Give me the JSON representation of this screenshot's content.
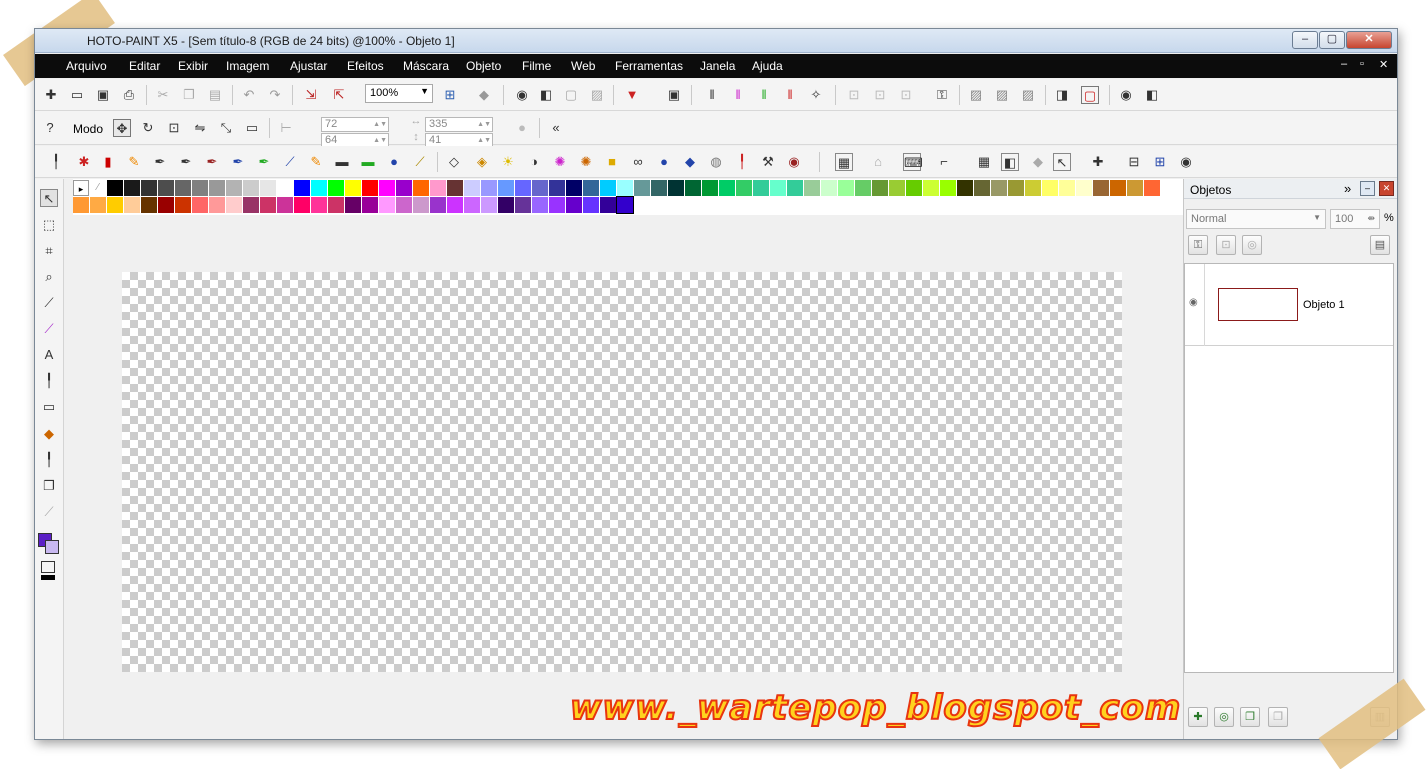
{
  "window": {
    "title": "HOTO-PAINT X5 - [Sem título-8 (RGB de 24 bits) @100% - Objeto 1]",
    "minimize_label": "–",
    "maximize_label": "▢",
    "close_label": "✕"
  },
  "menu": {
    "items": [
      "Arquivo",
      "Editar",
      "Exibir",
      "Imagem",
      "Ajustar",
      "Efeitos",
      "Máscara",
      "Objeto",
      "Filme",
      "Web",
      "Ferramentas",
      "Janela",
      "Ajuda"
    ],
    "mdi_controls": [
      "–",
      "▫",
      "✕"
    ]
  },
  "standard_toolbar": {
    "zoom_value": "100%",
    "icons": [
      "new-icon",
      "open-icon",
      "save-icon",
      "print-icon",
      "cut-icon",
      "copy-icon",
      "paste-icon",
      "undo-icon",
      "redo-icon",
      "import-icon",
      "export-icon",
      "zoom-to-fit-icon",
      "eye-icon",
      "layers-icon"
    ]
  },
  "property_bar": {
    "mode_label": "Modo",
    "x_value": "72",
    "y_value": "64",
    "width_value": "335",
    "height_value": "41"
  },
  "palette": {
    "row1": [
      "#000000",
      "#1a1a1a",
      "#333333",
      "#4d4d4d",
      "#666666",
      "#808080",
      "#999999",
      "#b3b3b3",
      "#cccccc",
      "#e6e6e6",
      "#ffffff",
      "#0000ff",
      "#00ffff",
      "#00ff00",
      "#ffff00",
      "#ff0000",
      "#ff00ff",
      "#9900cc",
      "#ff6600",
      "#ff99cc",
      "#663333",
      "#ccccff",
      "#9999ff",
      "#6699ff",
      "#6666ff",
      "#6666cc",
      "#333399",
      "#000066",
      "#336699",
      "#00ccff",
      "#99ffff",
      "#669999",
      "#336666",
      "#003333",
      "#006633",
      "#009933",
      "#00cc66",
      "#33cc66",
      "#33cc99",
      "#66ffcc",
      "#33cc99",
      "#99cc99",
      "#ccffcc",
      "#99ff99",
      "#66cc66",
      "#669933",
      "#99cc33",
      "#66cc00",
      "#ccff33",
      "#99ff00",
      "#333300",
      "#666633",
      "#999966",
      "#999933",
      "#cccc33",
      "#ffff66",
      "#ffff99",
      "#ffffcc",
      "#996633",
      "#cc6600",
      "#cc9933",
      "#ff6633"
    ],
    "row2": [
      "#ff9933",
      "#ffaa44",
      "#ffcc00",
      "#ffcc99",
      "#663300",
      "#990000",
      "#cc3300",
      "#ff6666",
      "#ff9999",
      "#ffcccc",
      "#993366",
      "#cc3366",
      "#cc3399",
      "#ff0066",
      "#ff3399",
      "#cc3366",
      "#660066",
      "#990099",
      "#ff99ff",
      "#cc66cc",
      "#cc99cc",
      "#9933cc",
      "#cc33ff",
      "#cc66ff",
      "#cc99ff",
      "#330066",
      "#663399",
      "#9966ff",
      "#9933ff",
      "#6600cc",
      "#6633ff",
      "#330099",
      "#3300cc"
    ]
  },
  "objects_panel": {
    "title": "Objetos",
    "blend_mode": "Normal",
    "opacity": "100",
    "percent_symbol": "%",
    "object_name": "Objeto 1",
    "collapse_label": "»"
  },
  "colors": {
    "foreground": "#5b1fc6",
    "background": "#c8b8f0"
  },
  "watermark": "www._wartepop_blogspot_com"
}
